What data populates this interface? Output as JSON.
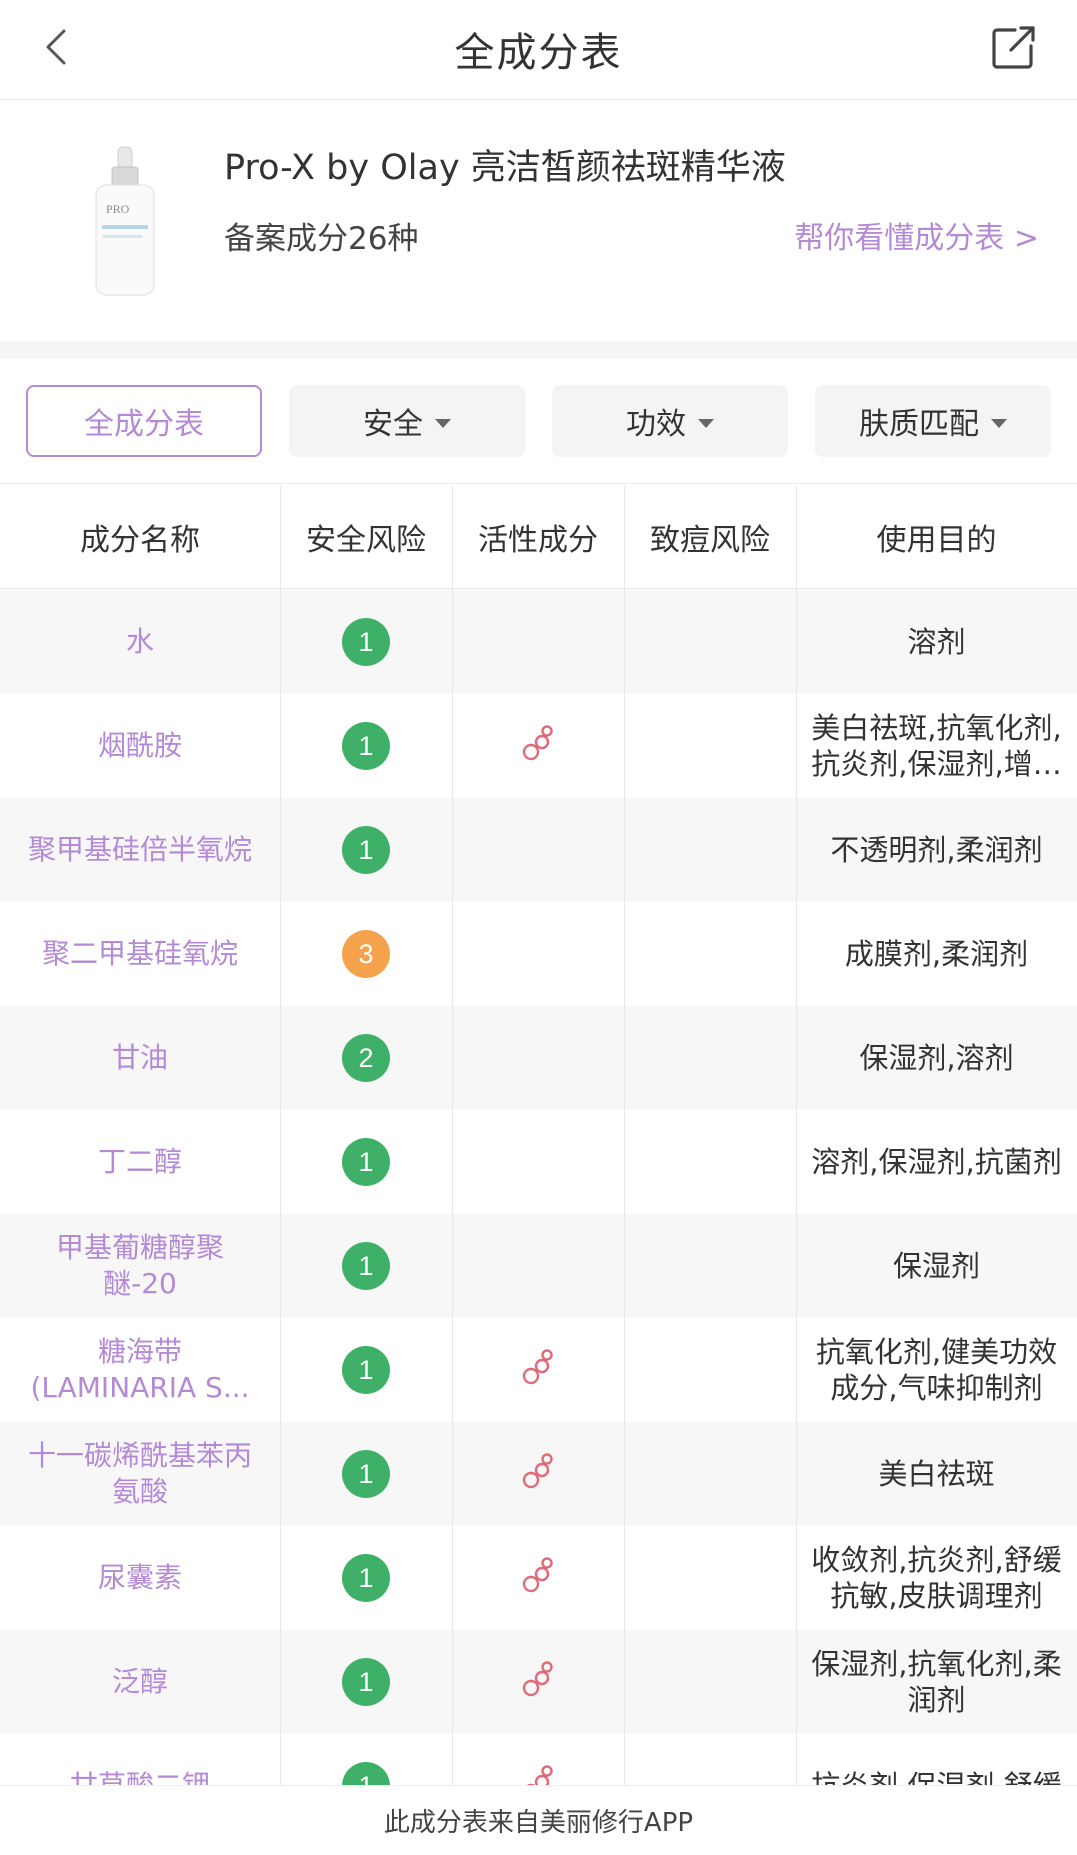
{
  "nav": {
    "title": "全成分表",
    "back_icon": "chevron-left-icon",
    "share_icon": "share-icon"
  },
  "product": {
    "name": "Pro-X by Olay 亮洁皙颜祛斑精华液",
    "ingredient_count": "备案成分26种",
    "help_link": "帮你看懂成分表 >"
  },
  "filters": [
    {
      "label": "全成分表",
      "active": true,
      "dropdown": false
    },
    {
      "label": "安全",
      "active": false,
      "dropdown": true
    },
    {
      "label": "功效",
      "active": false,
      "dropdown": true
    },
    {
      "label": "肤质匹配",
      "active": false,
      "dropdown": true
    }
  ],
  "table": {
    "headers": [
      "成分名称",
      "安全风险",
      "活性成分",
      "致痘风险",
      "使用目的"
    ],
    "rows": [
      {
        "name": [
          "水"
        ],
        "risk": "1",
        "active": false,
        "purpose": [
          "溶剂"
        ]
      },
      {
        "name": [
          "烟酰胺"
        ],
        "risk": "1",
        "active": true,
        "purpose": [
          "美白祛斑,抗氧化剂,",
          "抗炎剂,保湿剂,增…"
        ]
      },
      {
        "name": [
          "聚甲基硅倍半氧烷"
        ],
        "risk": "1",
        "active": false,
        "purpose": [
          "不透明剂,柔润剂"
        ]
      },
      {
        "name": [
          "聚二甲基硅氧烷"
        ],
        "risk": "3",
        "active": false,
        "purpose": [
          "成膜剂,柔润剂"
        ]
      },
      {
        "name": [
          "甘油"
        ],
        "risk": "2",
        "active": false,
        "purpose": [
          "保湿剂,溶剂"
        ]
      },
      {
        "name": [
          "丁二醇"
        ],
        "risk": "1",
        "active": false,
        "purpose": [
          "溶剂,保湿剂,抗菌剂"
        ]
      },
      {
        "name": [
          "甲基葡糖醇聚",
          "醚-20"
        ],
        "risk": "1",
        "active": false,
        "purpose": [
          "保湿剂"
        ]
      },
      {
        "name": [
          "糖海带",
          "(LAMINARIA S..."
        ],
        "risk": "1",
        "active": true,
        "purpose": [
          "抗氧化剂,健美功效",
          "成分,气味抑制剂"
        ]
      },
      {
        "name": [
          "十一碳烯酰基苯丙",
          "氨酸"
        ],
        "risk": "1",
        "active": true,
        "purpose": [
          "美白祛斑"
        ]
      },
      {
        "name": [
          "尿囊素"
        ],
        "risk": "1",
        "active": true,
        "purpose": [
          "收敛剂,抗炎剂,舒缓",
          "抗敏,皮肤调理剂"
        ]
      },
      {
        "name": [
          "泛醇"
        ],
        "risk": "1",
        "active": true,
        "purpose": [
          "保湿剂,抗氧化剂,柔",
          "润剂"
        ]
      },
      {
        "name": [
          "甘草酸二钾"
        ],
        "risk": "1",
        "active": true,
        "purpose": [
          "抗炎剂,保湿剂,舒缓"
        ]
      }
    ]
  },
  "footer": {
    "text": "此成分表来自美丽修行APP"
  }
}
